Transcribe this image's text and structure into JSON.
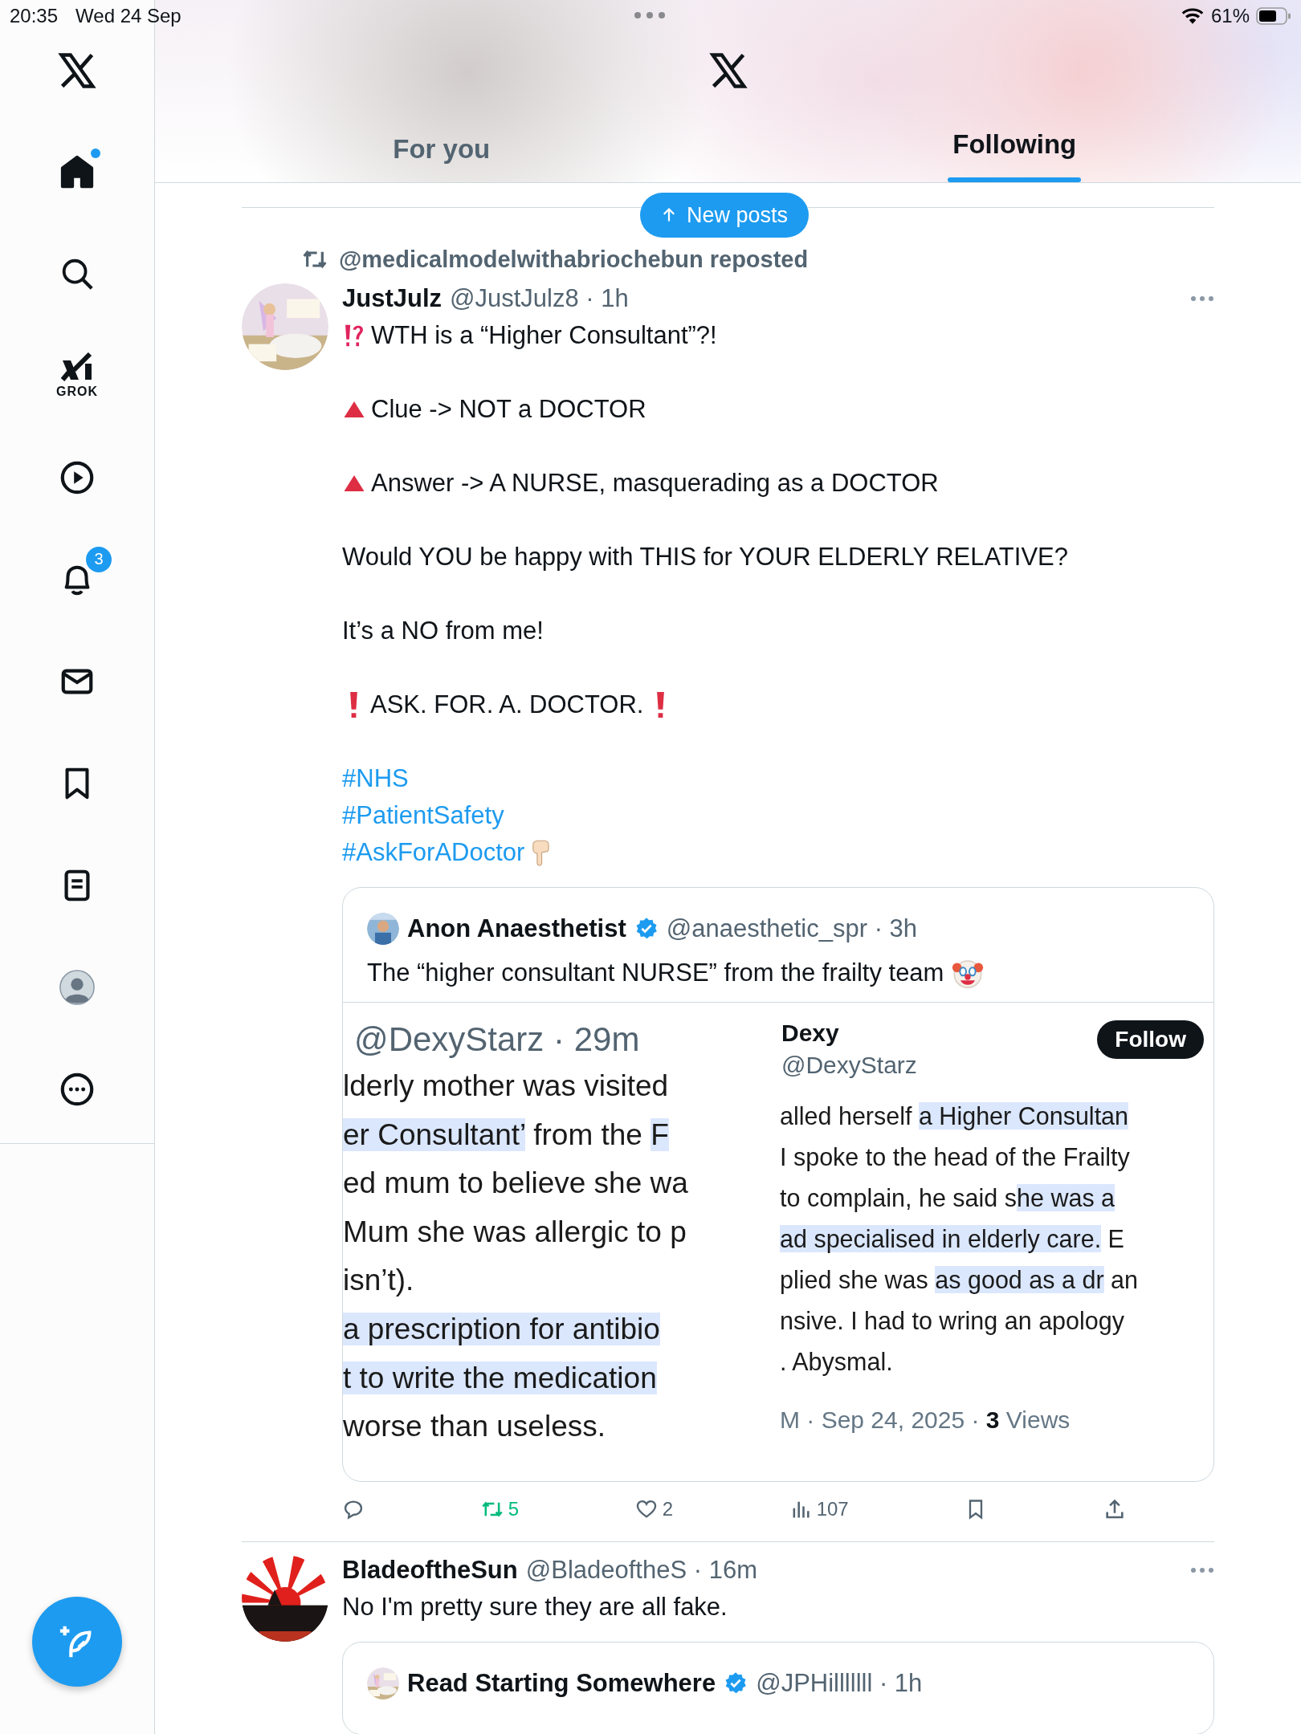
{
  "status_bar": {
    "time": "20:35",
    "date": "Wed 24 Sep",
    "battery": "61%"
  },
  "sidebar": {
    "items": [
      {
        "kind": "logo"
      },
      {
        "kind": "home",
        "selected": true,
        "dot": true
      },
      {
        "kind": "search",
        "selected": false
      },
      {
        "kind": "grok",
        "label": "GROK"
      },
      {
        "kind": "video",
        "selected": false
      },
      {
        "kind": "notifications",
        "selected": false,
        "badge": "3"
      },
      {
        "kind": "messages",
        "selected": false
      },
      {
        "kind": "bookmarks",
        "selected": false
      },
      {
        "kind": "lists",
        "selected": false
      },
      {
        "kind": "profile",
        "selected": false
      },
      {
        "kind": "more",
        "selected": false
      }
    ]
  },
  "compose_button": {
    "kind": "compose"
  },
  "header": {
    "tabs": [
      {
        "label": "For you",
        "selected": false
      },
      {
        "label": "Following",
        "selected": true
      }
    ]
  },
  "new_posts_button": {
    "label": "New posts"
  },
  "posts": [
    {
      "repost_by": "@medicalmodelwithabriochebun reposted",
      "name": "JustJulz",
      "meta": "@JustJulz8 · 1h",
      "body": [
        [
          {
            "kind": "headline",
            "text": "WTH is a “Higher Consultant”?!"
          }
        ],
        [
          {
            "kind": "point",
            "text": "Clue -> NOT a DOCTOR"
          }
        ],
        [
          {
            "kind": "point",
            "text": "Answer -> A NURSE, masquerading as a DOCTOR"
          }
        ],
        [
          {
            "kind": "plain",
            "text": "Would YOU be happy with THIS for YOUR ELDERLY RELATIVE?"
          }
        ],
        [
          {
            "kind": "plain",
            "text": "It’s a NO from me!"
          }
        ],
        [
          {
            "kind": "alert",
            "text": "ASK. FOR. A. DOCTOR."
          }
        ],
        [
          {
            "kind": "hashtag",
            "text": "#NHS"
          },
          {
            "kind": "hashtag",
            "text": "#PatientSafety"
          },
          {
            "kind": "hashtag-pointing",
            "text": "#AskForADoctor"
          }
        ]
      ],
      "quote": {
        "name": "Anon Anaesthetist",
        "verified": true,
        "meta": "@anaesthetic_spr · 3h",
        "text": "The “higher consultant NURSE” from the frailty team",
        "media": {
          "left": {
            "meta": "@DexyStarz · 29m",
            "lines": [
              [
                {
                  "text": "lderly mother was visited",
                  "marked": false
                }
              ],
              [
                {
                  "text": "er Consultant’",
                  "marked": true
                },
                {
                  "text": " from the ",
                  "marked": false
                },
                {
                  "text": "F",
                  "marked": true
                }
              ],
              [
                {
                  "text": "ed mum to believe she wa",
                  "marked": false
                }
              ],
              [
                {
                  "text": "Mum she was allergic to p",
                  "marked": false
                }
              ],
              [
                {
                  "text": "isn’t).",
                  "marked": false
                }
              ],
              [
                {
                  "text": "a prescription for antibio",
                  "marked": true
                }
              ],
              [
                {
                  "text": "t to write the medication",
                  "marked": true
                }
              ],
              [
                {
                  "text": "worse than useless.",
                  "marked": false
                }
              ]
            ]
          },
          "right": {
            "name": "Dexy",
            "handle": "@DexyStarz",
            "follow": "Follow",
            "lines": [
              [
                {
                  "text": "alled herself ",
                  "marked": false
                },
                {
                  "text": "a Higher Consultan",
                  "marked": true
                }
              ],
              [
                {
                  "text": "I spoke to the head of the Frailty",
                  "marked": false
                }
              ],
              [
                {
                  "text": "to complain,  he said s",
                  "marked": false
                },
                {
                  "text": "he was a",
                  "marked": true
                }
              ],
              [
                {
                  "text": "ad specialised in elderly care.",
                  "marked": true
                },
                {
                  "text": " E",
                  "marked": false
                }
              ],
              [
                {
                  "text": "plied she was ",
                  "marked": false
                },
                {
                  "text": "as good as a dr",
                  "marked": true
                },
                {
                  "text": " an",
                  "marked": false
                }
              ],
              [
                {
                  "text": "nsive. I had to wring an apology",
                  "marked": false
                }
              ],
              [
                {
                  "text": ". Abysmal.",
                  "marked": false
                }
              ]
            ],
            "footer": "M · Sep 24, 2025 · **3** Views"
          }
        }
      },
      "actions": [
        {
          "kind": "reply",
          "selected": false
        },
        {
          "kind": "repost",
          "count": "5",
          "selected": true
        },
        {
          "kind": "like",
          "count": "2",
          "selected": false
        },
        {
          "kind": "views",
          "count": "107"
        },
        {
          "kind": "bookmark",
          "selected": false
        },
        {
          "kind": "share"
        }
      ]
    },
    {
      "name": "BladeoftheSun",
      "meta": "@BladeoftheS · 16m",
      "body": [
        [
          {
            "kind": "plain",
            "text": "No I'm pretty sure they are all fake."
          }
        ]
      ],
      "quote": {
        "name": "Read Starting Somewhere",
        "verified": true,
        "meta": "@JPHilllllll · 1h"
      }
    }
  ]
}
